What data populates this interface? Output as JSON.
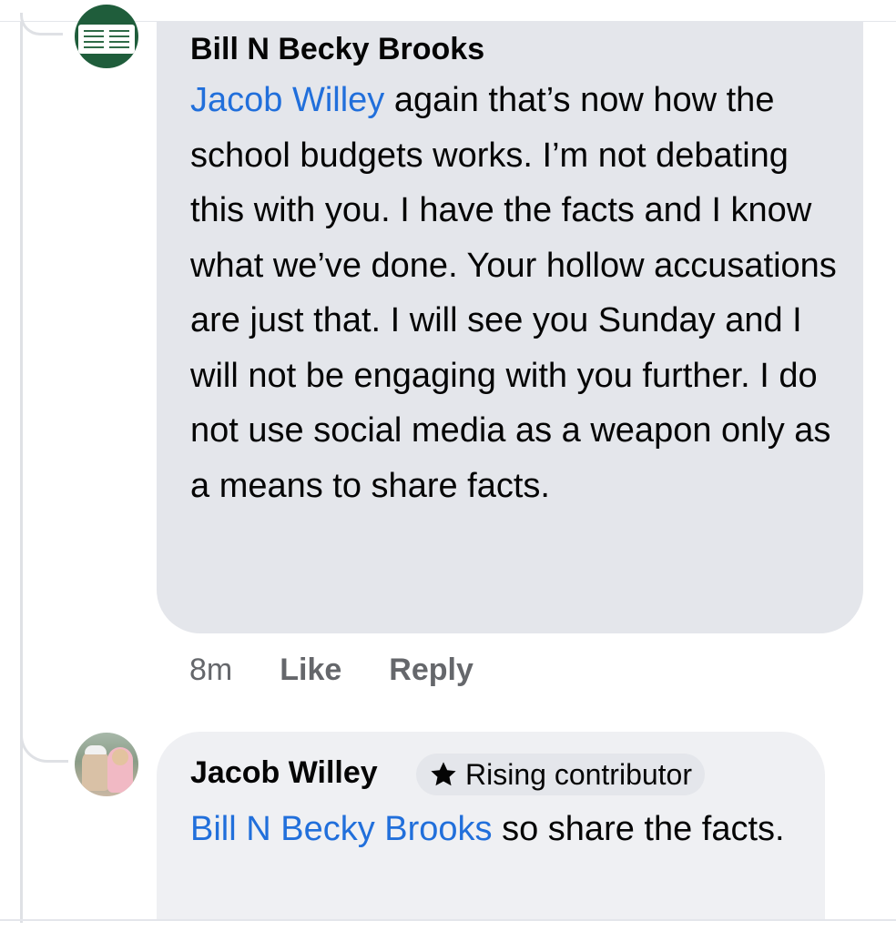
{
  "comments": [
    {
      "author": "Bill N Becky Brooks",
      "mention": "Jacob Willey",
      "text": " again that’s now how the school budgets works.  I’m not debating this with you.  I have the facts and I know what we’ve done.  Your hollow accusations are just that.  I will see you Sunday and I will not be engaging with you further.  I do not use social media as a weapon only as a means to share facts.",
      "time": "8m",
      "like_label": "Like",
      "reply_label": "Reply",
      "avatar_icon": "profile-photo-sign"
    },
    {
      "author": "Jacob Willey",
      "badge": "Rising contributor",
      "badge_icon": "star-icon",
      "mention": "Bill N Becky Brooks",
      "text": " so share the facts.",
      "avatar_icon": "profile-photo-couple"
    }
  ],
  "colors": {
    "mention": "#1877f2",
    "bubble": "#e4e6eb",
    "meta": "#65676b"
  }
}
